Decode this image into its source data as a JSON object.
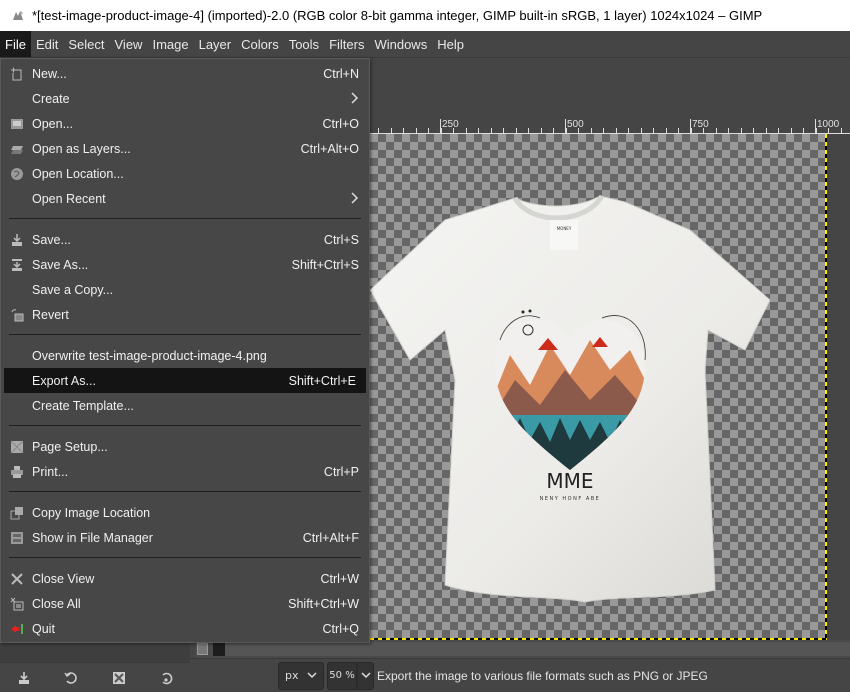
{
  "window": {
    "title": "*[test-image-product-image-4] (imported)-2.0 (RGB color 8-bit gamma integer, GIMP built-in sRGB, 1 layer) 1024x1024 – GIMP"
  },
  "menubar": {
    "items": [
      "File",
      "Edit",
      "Select",
      "View",
      "Image",
      "Layer",
      "Colors",
      "Tools",
      "Filters",
      "Windows",
      "Help"
    ],
    "active": "File"
  },
  "file_menu": {
    "groups": [
      [
        {
          "icon": "new-image-icon",
          "label": "New...",
          "accel": "Ctrl+N"
        },
        {
          "icon": "",
          "label": "Create",
          "submenu": true
        },
        {
          "icon": "open-icon",
          "label": "Open...",
          "accel": "Ctrl+O"
        },
        {
          "icon": "open-as-layers-icon",
          "label": "Open as Layers...",
          "accel": "Ctrl+Alt+O"
        },
        {
          "icon": "globe-icon",
          "label": "Open Location...",
          "accel": ""
        },
        {
          "icon": "",
          "label": "Open Recent",
          "submenu": true
        }
      ],
      [
        {
          "icon": "save-icon",
          "label": "Save...",
          "accel": "Ctrl+S"
        },
        {
          "icon": "save-as-icon",
          "label": "Save As...",
          "accel": "Shift+Ctrl+S"
        },
        {
          "icon": "",
          "label": "Save a Copy...",
          "accel": ""
        },
        {
          "icon": "revert-icon",
          "label": "Revert",
          "accel": ""
        }
      ],
      [
        {
          "icon": "",
          "label": "Overwrite test-image-product-image-4.png",
          "accel": ""
        },
        {
          "icon": "",
          "label": "Export As...",
          "accel": "Shift+Ctrl+E",
          "highlighted": true
        },
        {
          "icon": "",
          "label": "Create Template...",
          "accel": ""
        }
      ],
      [
        {
          "icon": "page-setup-icon",
          "label": "Page Setup...",
          "accel": ""
        },
        {
          "icon": "print-icon",
          "label": "Print...",
          "accel": "Ctrl+P"
        }
      ],
      [
        {
          "icon": "copy-location-icon",
          "label": "Copy Image Location",
          "accel": ""
        },
        {
          "icon": "file-manager-icon",
          "label": "Show in File Manager",
          "accel": "Ctrl+Alt+F"
        }
      ],
      [
        {
          "icon": "close-icon",
          "label": "Close View",
          "accel": "Ctrl+W"
        },
        {
          "icon": "close-all-icon",
          "label": "Close All",
          "accel": "Shift+Ctrl+W"
        },
        {
          "icon": "quit-icon",
          "label": "Quit",
          "accel": "Ctrl+Q"
        }
      ]
    ]
  },
  "ruler": {
    "labels": [
      "250",
      "500",
      "750",
      "1000"
    ]
  },
  "canvas": {
    "image_description": "White t-shirt with heart-shaped mountain and forest graphic",
    "print_text": "MME",
    "print_subtext": "NENY HONF ABE",
    "accent_colors": {
      "mountain_orange": "#d98a5c",
      "peak_red": "#cc2a1a",
      "forest_teal": "#3a9aa6",
      "selection_dash": "#ffeb00"
    }
  },
  "dock_buttons": [
    "save-tool-preset-icon",
    "restore-tool-preset-icon",
    "delete-tool-preset-icon",
    "reset-tool-preset-icon"
  ],
  "statusbar": {
    "unit": "px",
    "zoom": "50 %",
    "message": "Export the image to various file formats such as PNG or JPEG"
  }
}
